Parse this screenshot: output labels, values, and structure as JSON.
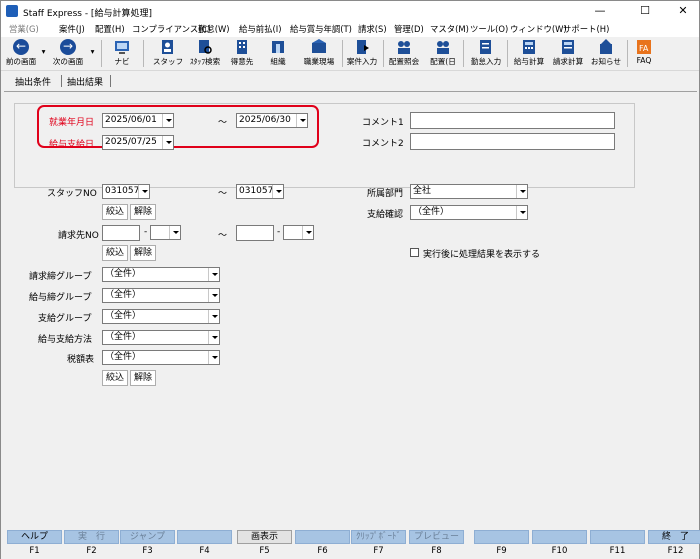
{
  "window": {
    "title": "Staff Express - [給与計算処理]",
    "minimize": "—",
    "maximize": "☐",
    "close": "✕"
  },
  "menu": [
    "営業(G)",
    "案件(J)",
    "配置(H)",
    "コンプライアンス(C)",
    "勤怠(W)",
    "給与前払(I)",
    "給与賞与年調(T)",
    "請求(S)",
    "管理(D)",
    "マスタ(M)",
    "ツール(O)",
    "ウィンドウ(W)",
    "サポート(H)"
  ],
  "toolbar": {
    "back": "前の画面",
    "next": "次の画面",
    "nav": "ナビ",
    "staff": "スタッフ",
    "staff_search": "ｽﾀｯﾌ検索",
    "customer": "得意先",
    "organization": "組織",
    "staff_site": "職業現場",
    "case_entry": "案件入力",
    "assign_view": "配置照会",
    "assign_day": "配置(日",
    "attendance_entry": "勤怠入力",
    "payroll": "給与計算",
    "billing": "請求計算",
    "notice": "お知らせ",
    "faq": "FAQ"
  },
  "tabs": {
    "conditions": "抽出条件",
    "results": "抽出結果"
  },
  "form": {
    "work_month_label": "就業年月日",
    "work_from": "2025/06/01",
    "tilde": "～",
    "work_to": "2025/06/30",
    "pay_date_label": "給与支給日",
    "pay_date": "2025/07/25",
    "comment1_label": "コメント1",
    "comment2_label": "コメント2",
    "staff_no_label": "スタッフNO",
    "staff_from": "031057",
    "staff_to": "031057",
    "narrow_btn": "絞込",
    "clear_btn": "解除",
    "billing_no_label": "請求先NO",
    "dept_label": "所属部門",
    "dept_value": "全社",
    "payment_confirm_label": "支給確認",
    "all_value": "（全件）",
    "show_results_label": "実行後に処理結果を表示する",
    "billing_close_group_label": "請求締グループ",
    "pay_close_group_label": "給与締グループ",
    "pay_group_label": "支給グループ",
    "pay_method_label": "給与支給方法",
    "tax_table_label": "税額表"
  },
  "fkeys": [
    {
      "label": "ヘルプ",
      "num": "F1",
      "enabled": true
    },
    {
      "label": "実　行",
      "num": "F2",
      "enabled": false
    },
    {
      "label": "ジャンプ",
      "num": "F3",
      "enabled": false
    },
    {
      "label": "",
      "num": "F4",
      "enabled": false
    },
    {
      "label": "画表示",
      "num": "F5",
      "enabled": true
    },
    {
      "label": "",
      "num": "F6",
      "enabled": false
    },
    {
      "label": "ｸﾘｯﾌﾟﾎﾞｰﾄﾞ",
      "num": "F7",
      "enabled": false
    },
    {
      "label": "プレビュー",
      "num": "F8",
      "enabled": false
    },
    {
      "label": "",
      "num": "F9",
      "enabled": false
    },
    {
      "label": "",
      "num": "F10",
      "enabled": false
    },
    {
      "label": "",
      "num": "F11",
      "enabled": false
    },
    {
      "label": "終　了",
      "num": "F12",
      "enabled": true
    }
  ]
}
